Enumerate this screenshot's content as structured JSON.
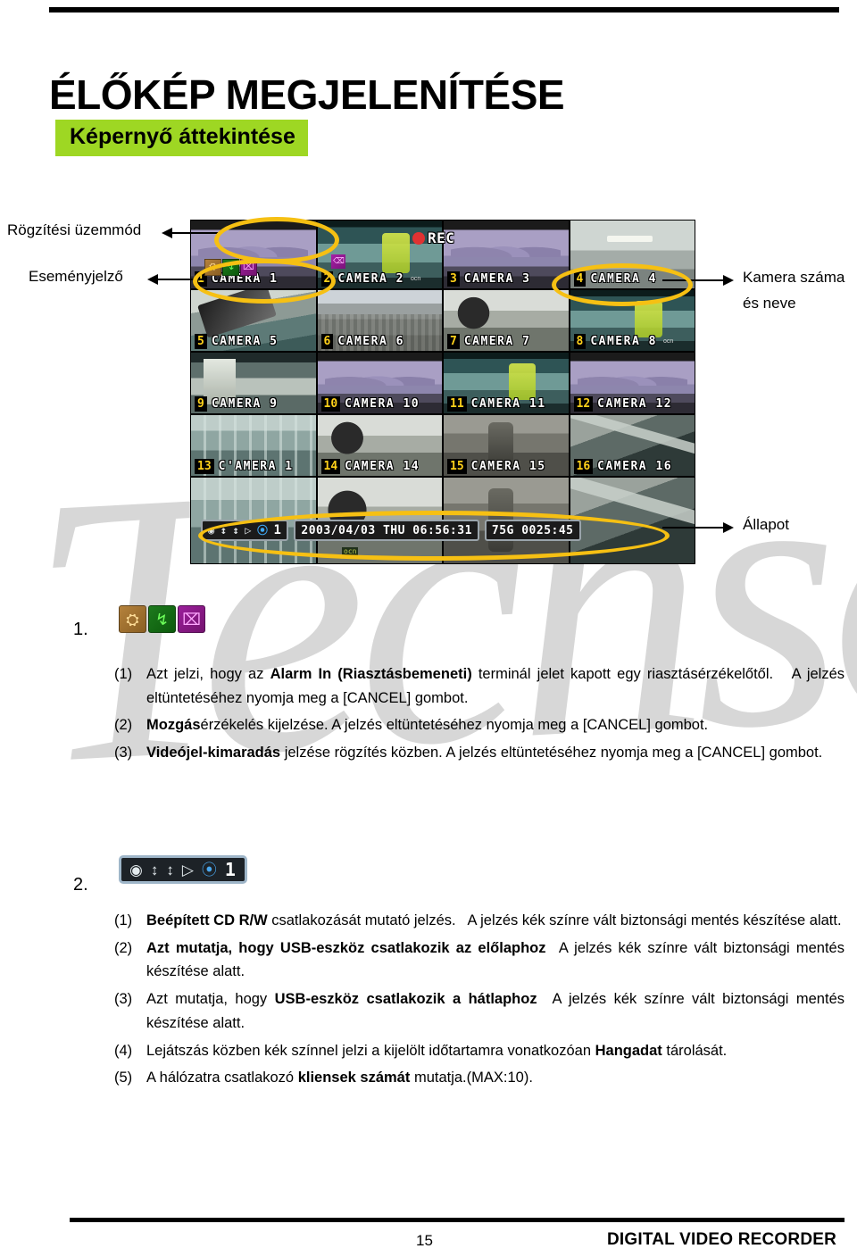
{
  "page": {
    "title": "ÉLŐKÉP MEGJELENÍTÉSE",
    "section_title": "Képernyő áttekintése",
    "accent_green": "#9ed723",
    "highlight_yellow": "#f6c013",
    "watermark_text": "Techson"
  },
  "callouts": {
    "recording_mode": "Rögzítési üzemmód",
    "event_indicator": "Eseményjelző",
    "camera_number_line1": "Kamera száma",
    "camera_number_line2": "és neve",
    "status": "Állapot"
  },
  "dvr": {
    "rec_label": "REC",
    "ocn_mark": "ocn",
    "cameras": [
      {
        "num": "1",
        "name": "CAMERA 1",
        "scene": "sc-mountain",
        "ocn": false
      },
      {
        "num": "2",
        "name": "CAMERA 2",
        "scene": "sc-bus",
        "ocn": true
      },
      {
        "num": "3",
        "name": "CAMERA 3",
        "scene": "sc-mountain",
        "ocn": false
      },
      {
        "num": "4",
        "name": "CAMERA 4",
        "scene": "sc-ceiling",
        "ocn": false
      },
      {
        "num": "5",
        "name": "CAMERA 5",
        "scene": "sc-hand",
        "ocn": false
      },
      {
        "num": "6",
        "name": "CAMERA 6",
        "scene": "sc-city",
        "ocn": false
      },
      {
        "num": "7",
        "name": "CAMERA 7",
        "scene": "sc-room",
        "ocn": false
      },
      {
        "num": "8",
        "name": "CAMERA 8",
        "scene": "sc-bus",
        "ocn": true
      },
      {
        "num": "9",
        "name": "CAMERA 9",
        "scene": "sc-office",
        "ocn": false
      },
      {
        "num": "10",
        "name": "CAMERA 10",
        "scene": "sc-mountain",
        "ocn": false
      },
      {
        "num": "11",
        "name": "CAMERA 11",
        "scene": "sc-bus",
        "ocn": false
      },
      {
        "num": "12",
        "name": "CAMERA 12",
        "scene": "sc-mountain",
        "ocn": false
      },
      {
        "num": "13",
        "name": "C'AMERA 1",
        "scene": "sc-glass",
        "ocn": false
      },
      {
        "num": "14",
        "name": "CAMERA 14",
        "scene": "sc-room",
        "ocn": false
      },
      {
        "num": "15",
        "name": "CAMERA 15",
        "scene": "sc-worker",
        "ocn": false
      },
      {
        "num": "16",
        "name": "CAMERA 16",
        "scene": "sc-metal",
        "ocn": false
      }
    ],
    "event_icons": [
      {
        "name": "alarm-in-icon",
        "glyph": "⛭",
        "class": "evt-alarm"
      },
      {
        "name": "motion-icon",
        "glyph": "↯",
        "class": "evt-motion"
      },
      {
        "name": "video-loss-icon",
        "glyph": "⌧",
        "class": "evt-vloss"
      }
    ],
    "status_bar": {
      "device_icons": [
        {
          "name": "cd-rw-icon",
          "glyph": "◉",
          "class": ""
        },
        {
          "name": "usb-front-icon",
          "glyph": "↕",
          "class": ""
        },
        {
          "name": "usb-rear-icon",
          "glyph": "↕",
          "class": ""
        },
        {
          "name": "audio-icon",
          "glyph": "▷",
          "class": ""
        },
        {
          "name": "network-icon",
          "glyph": "⦿",
          "class": "net"
        }
      ],
      "client_count": "1",
      "datetime": "2003/04/03 THU 06:56:31",
      "capacity": "75G  0025:45"
    }
  },
  "sections": [
    {
      "marker": "1.",
      "icons": [
        {
          "name": "alarm-in-icon",
          "glyph": "⛭",
          "class": "evt-alarm"
        },
        {
          "name": "motion-icon",
          "glyph": "↯",
          "class": "evt-motion"
        },
        {
          "name": "video-loss-icon",
          "glyph": "⌧",
          "class": "evt-vloss"
        }
      ],
      "items": [
        {
          "marker": "(1)",
          "html": "Azt jelzi, hogy az <b>Alarm In (Riasztásbemeneti)</b> terminál jelet kapott egy riasztásérzékelőtől.&nbsp;&nbsp; A jelzés eltüntetéséhez nyomja meg a [CANCEL] gombot."
        },
        {
          "marker": "(2)",
          "html": "<b>Mozgás</b>érzékelés kijelzése. A jelzés eltüntetéséhez nyomja meg a [CANCEL] gombot."
        },
        {
          "marker": "(3)",
          "html": "<b>Videójel-kimaradás</b> jelzése rögzítés közben. A jelzés eltüntetéséhez nyomja meg a [CANCEL] gombot."
        }
      ]
    },
    {
      "marker": "2.",
      "icons": [
        {
          "name": "cd-rw-icon",
          "glyph": "◉",
          "class": ""
        },
        {
          "name": "usb-front-icon",
          "glyph": "↕",
          "class": ""
        },
        {
          "name": "usb-rear-icon",
          "glyph": "↕",
          "class": ""
        },
        {
          "name": "audio-icon",
          "glyph": "▷",
          "class": ""
        },
        {
          "name": "network-icon",
          "glyph": "⦿",
          "class": "net"
        }
      ],
      "client_count": "1",
      "items": [
        {
          "marker": "(1)",
          "html": "<b>Beépített CD R/W</b> csatlakozását mutató jelzés.&nbsp;&nbsp; A jelzés kék színre vált biztonsági mentés készítése alatt."
        },
        {
          "marker": "(2)",
          "html": "<b>Azt mutatja, hogy USB-eszköz csatlakozik az előlaphoz</b>&nbsp;&nbsp;A jelzés kék színre vált biztonsági mentés készítése alatt."
        },
        {
          "marker": "(3)",
          "html": "Azt mutatja, hogy <b>USB-eszköz csatlakozik a hátlaphoz</b>&nbsp;&nbsp;A jelzés kék színre vált biztonsági mentés készítése alatt."
        },
        {
          "marker": "(4)",
          "html": "Lejátszás közben kék színnel jelzi a kijelölt időtartamra vonatkozóan <b>Hangadat</b> tárolását."
        },
        {
          "marker": "(5)",
          "html": "A hálózatra csatlakozó <b>kliensek számát</b> mutatja.(MAX:10)."
        }
      ]
    }
  ],
  "footer": {
    "page_number": "15",
    "doc_title": "DIGITAL VIDEO RECORDER"
  }
}
